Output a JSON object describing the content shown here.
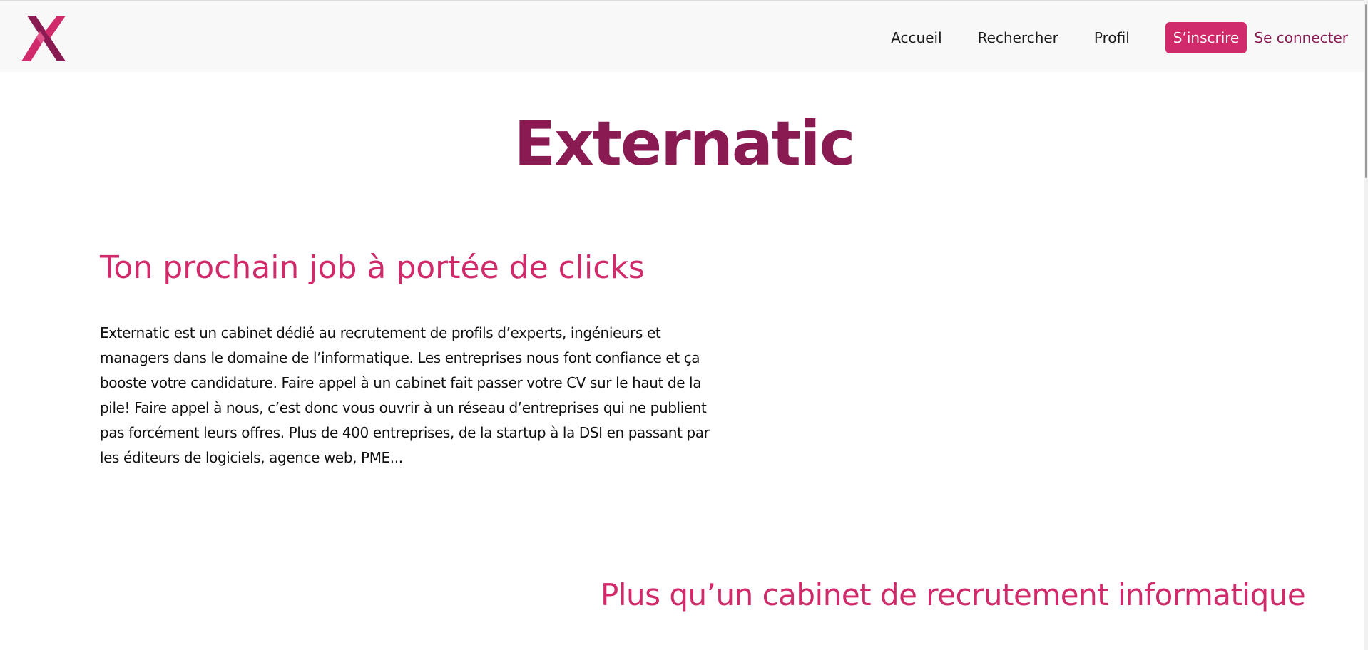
{
  "header": {
    "logo_icon": "externatic-x-logo",
    "nav": {
      "home": "Accueil",
      "search": "Rechercher",
      "profile": "Profil"
    },
    "signup_label": "S’inscrire",
    "login_label": "Se connecter"
  },
  "main": {
    "title": "Externatic",
    "hero_heading": "Ton prochain job à portée de clicks",
    "intro": "Externatic est un cabinet dédié au recrutement de profils d’experts, ingénieurs et managers dans le domaine de l’informatique. Les entreprises nous font confiance et ça booste votre candidature. Faire appel à un cabinet fait passer votre CV sur le haut de la pile! Faire appel à nous, c’est donc vous ouvrir à un réseau d’entreprises qui ne publient pas forcément leurs offres. Plus de 400 entreprises, de la startup à la DSI en passant par les éditeurs de logiciels, agence web, PME...",
    "second_heading": "Plus qu’un cabinet de recrutement informatique"
  },
  "colors": {
    "primary": "#d12a6a",
    "dark_primary": "#8a1a52",
    "header_bg": "#f8f8f8"
  }
}
